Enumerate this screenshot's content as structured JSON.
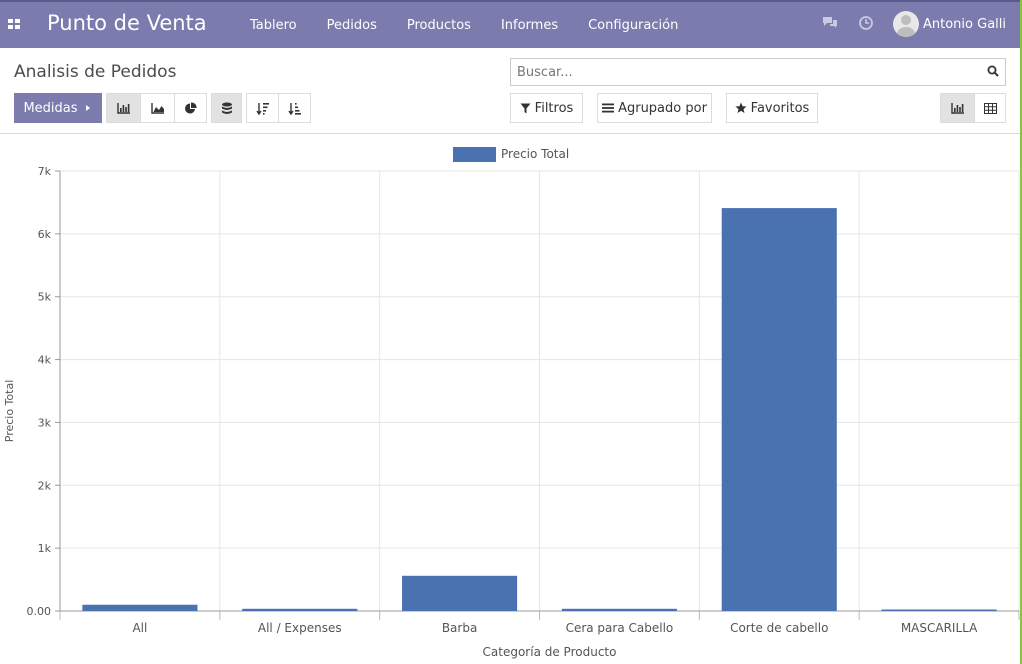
{
  "navbar": {
    "brand": "Punto de Venta",
    "menu": [
      "Tablero",
      "Pedidos",
      "Productos",
      "Informes",
      "Configuración"
    ],
    "user_name": "Antonio Galli",
    "colors": {
      "bar": "#7c7bad",
      "text": "#ffffff"
    }
  },
  "control_panel": {
    "title": "Analisis de Pedidos",
    "search_placeholder": "Buscar...",
    "measures_label": "Medidas",
    "filters_label": "Filtros",
    "groupby_label": "Agrupado por",
    "favorites_label": "Favoritos"
  },
  "chart_data": {
    "type": "bar",
    "categories": [
      "All",
      "All / Expenses",
      "Barba",
      "Cera para Cabello",
      "Corte de cabello",
      "MASCARILLA"
    ],
    "series": [
      {
        "name": "Precio Total",
        "values": [
          100,
          35,
          560,
          35,
          6410,
          5
        ],
        "color": "#4a72b0"
      }
    ],
    "xlabel": "Categoría de Producto",
    "ylabel": "Precio Total",
    "ylim": [
      0,
      7000
    ],
    "y_ticks": [
      "0.00",
      "1k",
      "2k",
      "3k",
      "4k",
      "5k",
      "6k",
      "7k"
    ],
    "legend": "top-center",
    "grid": true
  }
}
